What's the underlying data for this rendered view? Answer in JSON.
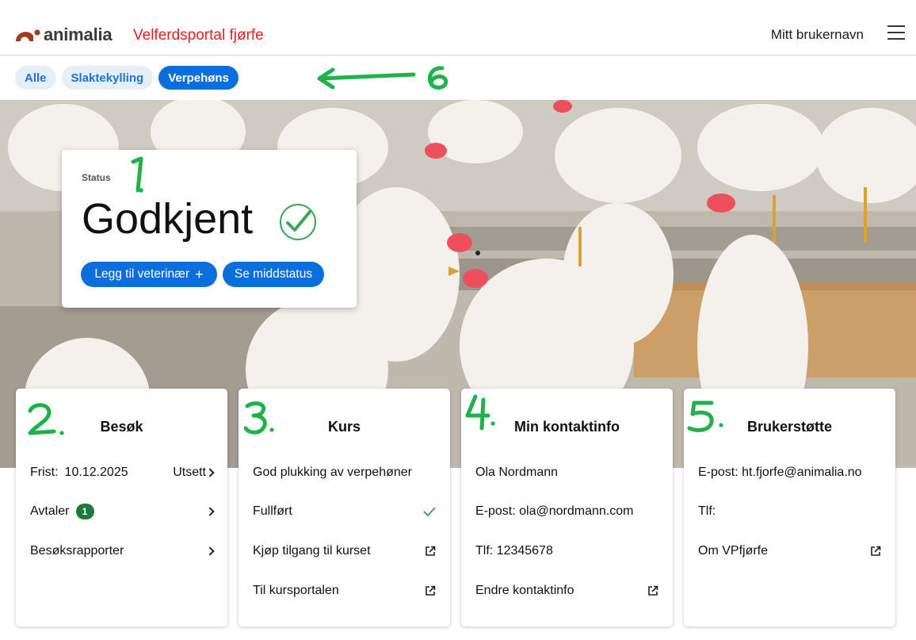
{
  "header": {
    "logo_text": "animalia",
    "portal_title": "Velferdsportal fjørfe",
    "username": "Mitt brukernavn",
    "menu_icon": "hamburger-icon"
  },
  "filters": [
    {
      "label": "Alle",
      "active": false
    },
    {
      "label": "Slaktekylling",
      "active": false
    },
    {
      "label": "Verpehøns",
      "active": true
    }
  ],
  "status": {
    "label": "Status",
    "value": "Godkjent",
    "add_vet_label": "Legg til veterinær",
    "mid_status_label": "Se middstatus"
  },
  "cards": {
    "besok": {
      "title": "Besøk",
      "deadline_label": "Frist:",
      "deadline_value": "10.12.2025",
      "postpone_label": "Utsett",
      "appointments_label": "Avtaler",
      "appointments_count": "1",
      "reports_label": "Besøksrapporter"
    },
    "kurs": {
      "title": "Kurs",
      "course_name": "God plukking av verpehøner",
      "completed_label": "Fullført",
      "buy_access_label": "Kjøp tilgang til kurset",
      "portal_label": "Til kursportalen"
    },
    "kontakt": {
      "title": "Min kontaktinfo",
      "name": "Ola Nordmann",
      "email": "E-post: ola@nordmann.com",
      "phone": "Tlf: 12345678",
      "edit_label": "Endre kontaktinfo"
    },
    "support": {
      "title": "Brukerstøtte",
      "email": "E-post: ht.fjorfe@animalia.no",
      "phone": "Tlf:",
      "about_label": "Om VPfjørfe"
    }
  },
  "annotations": [
    "1.",
    "2.",
    "3.",
    "4.",
    "5.",
    "6"
  ],
  "colors": {
    "brand_red": "#e1201f",
    "primary_blue": "#0a6fdc",
    "chip_bg": "#e6eef8",
    "success_green": "#3aa655",
    "badge_green": "#1c7a3c",
    "annotation_green": "#1fb14a"
  }
}
